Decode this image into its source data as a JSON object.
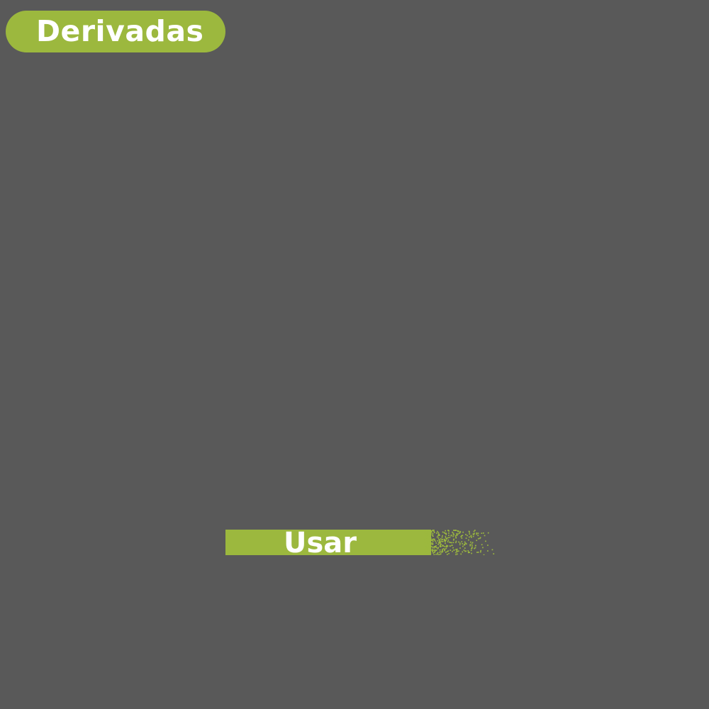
{
  "header": {
    "title": "Derivadas"
  },
  "actions": {
    "use_label": "Usar"
  },
  "colors": {
    "background": "#595959",
    "accent": "#9cb83e",
    "text": "#ffffff"
  }
}
